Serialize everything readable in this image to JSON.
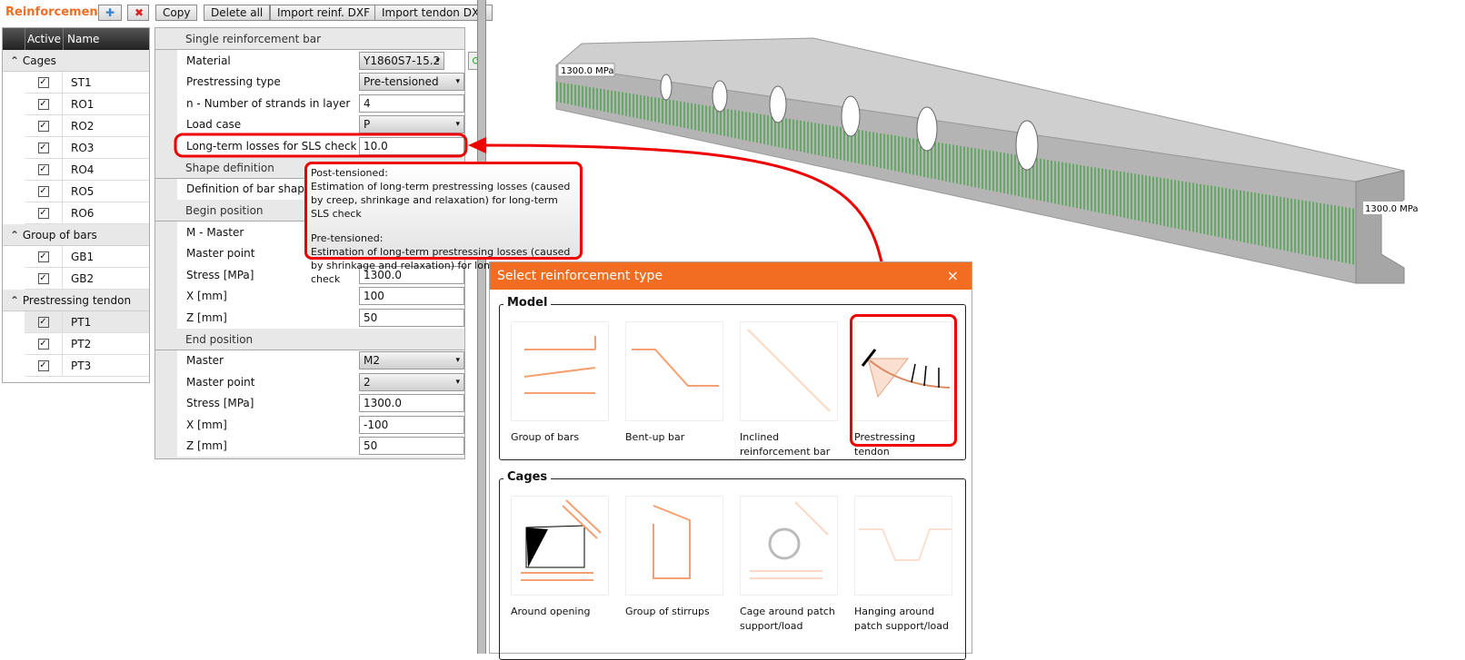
{
  "toolbar": {
    "title": "Reinforcement",
    "copy": "Copy",
    "delete_all": "Delete all",
    "import_reinf": "Import reinf. DXF",
    "import_tendon": "Import tendon DXF"
  },
  "tree": {
    "col_active": "Active",
    "col_name": "Name",
    "groups": [
      {
        "label": "Cages",
        "items": [
          "ST1",
          "RO1",
          "RO2",
          "RO3",
          "RO4",
          "RO5",
          "RO6"
        ]
      },
      {
        "label": "Group of bars",
        "items": [
          "GB1",
          "GB2"
        ]
      },
      {
        "label": "Prestressing tendon",
        "items": [
          "PT1",
          "PT2",
          "PT3"
        ]
      }
    ]
  },
  "props": {
    "s1": "Single reinforcement bar",
    "material_l": "Material",
    "material_v": "Y1860S7-15.2",
    "ptype_l": "Prestressing type",
    "ptype_v": "Pre-tensioned",
    "n_l": "n - Number of strands in layer",
    "n_v": "4",
    "lc_l": "Load case",
    "lc_v": "P",
    "ltl_l": "Long-term losses for SLS check [%]",
    "ltl_v": "10.0",
    "s2": "Shape definition",
    "def_l": "Definition of bar shape",
    "s3": "Begin position",
    "bm_l": "M - Master",
    "bmp_l": "Master point",
    "bs_l": "Stress [MPa]",
    "bs_v": "1300.0",
    "bx_l": "X [mm]",
    "bx_v": "100",
    "bz_l": "Z [mm]",
    "bz_v": "50",
    "s4": "End position",
    "em_l": "Master",
    "em_v": "M2",
    "emp_l": "Master point",
    "emp_v": "2",
    "es_l": "Stress [MPa]",
    "es_v": "1300.0",
    "ex_l": "X [mm]",
    "ex_v": "-100",
    "ez_l": "Z [mm]",
    "ez_v": "50"
  },
  "tooltip": {
    "h1": "Post-tensioned:",
    "t1": "Estimation of long-term prestressing losses (caused by creep, shrinkage and relaxation) for long-term SLS check",
    "h2": "Pre-tensioned:",
    "t2": "Estimation of long-term prestressing losses (caused by shrinkage and relaxation) for long-term SLS check"
  },
  "view": {
    "stress_left": "1300.0 MPa",
    "stress_right": "1300.0 MPa"
  },
  "dialog": {
    "title": "Select reinforcement type",
    "close": "×",
    "model": "Model",
    "cages": "Cages",
    "model_items": [
      "Group of bars",
      "Bent-up bar",
      "Inclined reinforcement bar",
      "Prestressing tendon"
    ],
    "cage_items": [
      "Around opening",
      "Group of stirrups",
      "Cage around patch support/load",
      "Hanging around patch support/load"
    ]
  },
  "colors": {
    "accent": "#f26d21",
    "highlight": "#e00000"
  }
}
